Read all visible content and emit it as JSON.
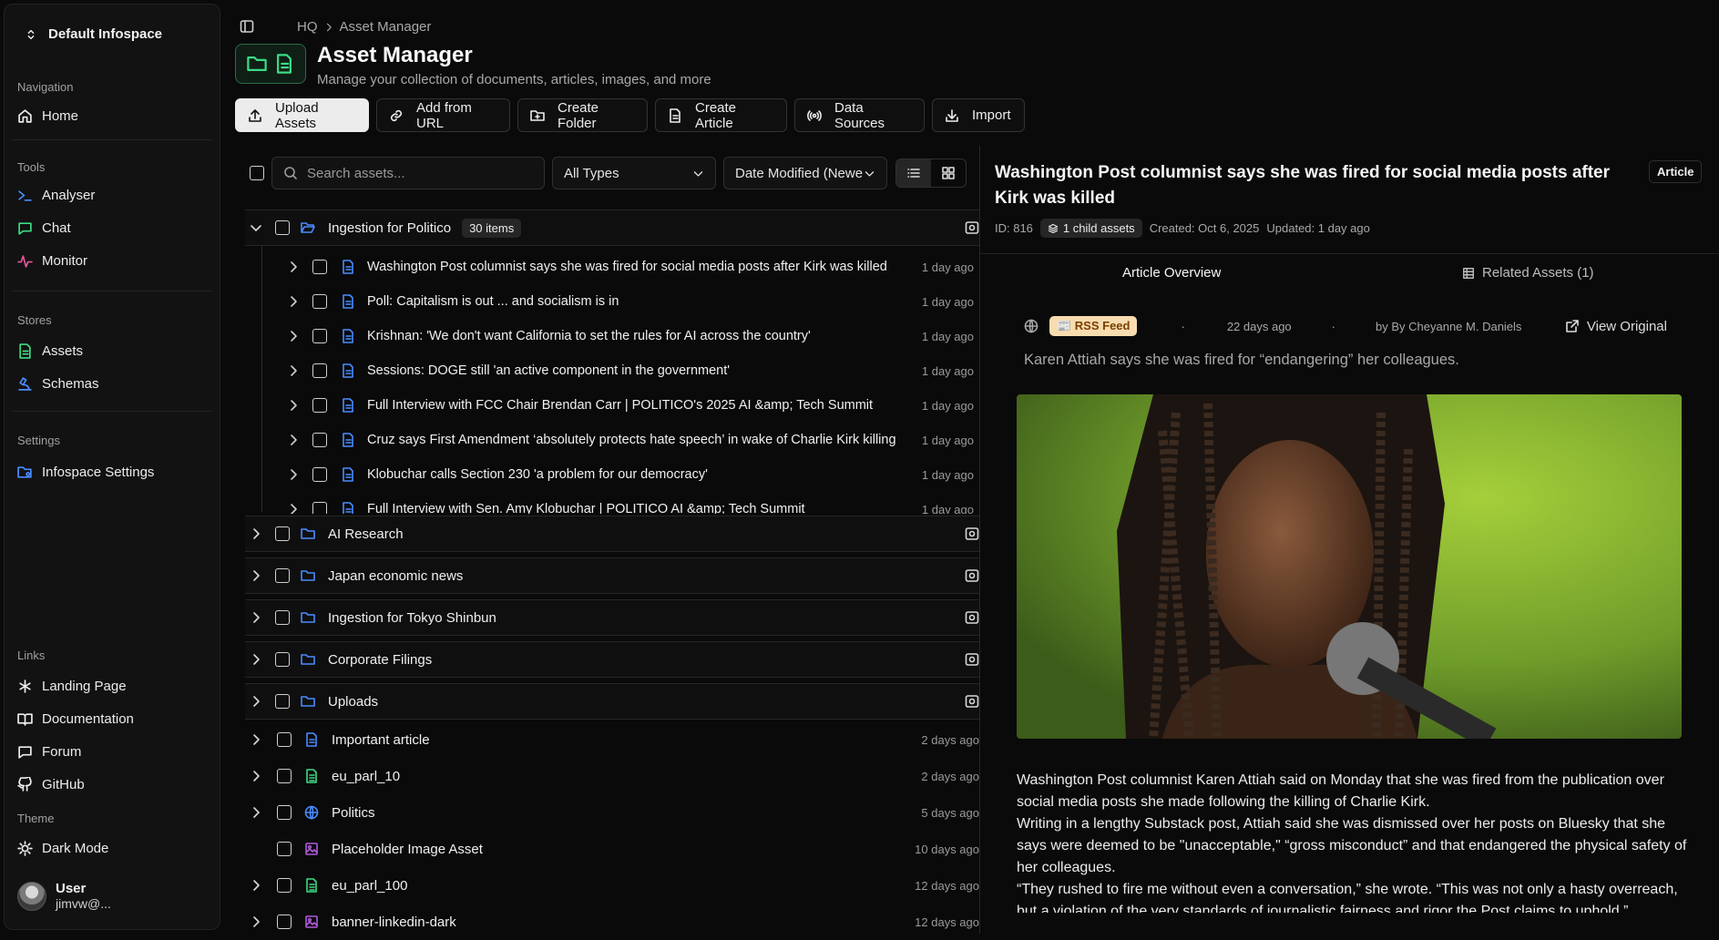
{
  "sidebar": {
    "workspace": "Default Infospace",
    "sections": {
      "navigation": "Navigation",
      "tools": "Tools",
      "stores": "Stores",
      "settings": "Settings",
      "links": "Links",
      "theme": "Theme"
    },
    "items": {
      "home": "Home",
      "analyser": "Analyser",
      "chat": "Chat",
      "monitor": "Monitor",
      "assets": "Assets",
      "schemas": "Schemas",
      "infospace_settings": "Infospace Settings",
      "landing": "Landing Page",
      "docs": "Documentation",
      "forum": "Forum",
      "github": "GitHub",
      "dark_mode": "Dark Mode"
    },
    "user": {
      "name": "User",
      "email": "jimvw@..."
    }
  },
  "header": {
    "breadcrumb": [
      "HQ",
      "Asset Manager"
    ],
    "title": "Asset Manager",
    "subtitle": "Manage your collection of documents, articles, images, and more"
  },
  "toolbar": {
    "upload": "Upload Assets",
    "add_url": "Add from URL",
    "create_folder": "Create Folder",
    "create_article": "Create Article",
    "data_sources": "Data Sources",
    "import": "Import"
  },
  "filters": {
    "search_placeholder": "Search assets...",
    "type": "All Types",
    "sort": "Date Modified (Newest)"
  },
  "tree": {
    "open_folder": {
      "name": "Ingestion for Politico",
      "count": "30 items",
      "children": [
        {
          "title": "Washington Post columnist says she was fired for social media posts after Kirk was killed",
          "date": "1 day ago"
        },
        {
          "title": "Poll: Capitalism is out ... and socialism is in",
          "date": "1 day ago"
        },
        {
          "title": "Krishnan: 'We don't want California to set the rules for AI across the country'",
          "date": "1 day ago"
        },
        {
          "title": "Sessions: DOGE still 'an active component in the government'",
          "date": "1 day ago"
        },
        {
          "title": "Full Interview with FCC Chair Brendan Carr | POLITICO's 2025 AI &amp; Tech Summit",
          "date": "1 day ago"
        },
        {
          "title": "Cruz says First Amendment ‘absolutely protects hate speech’ in wake of Charlie Kirk killing",
          "date": "1 day ago"
        },
        {
          "title": "Klobuchar calls Section 230 'a problem for our democracy'",
          "date": "1 day ago"
        },
        {
          "title": "Full Interview with Sen. Amy Klobuchar | POLITICO AI &amp; Tech Summit",
          "date": "1 day ago"
        }
      ]
    },
    "folders": [
      "AI Research",
      "Japan economic news",
      "Ingestion for Tokyo Shinbun",
      "Corporate Filings",
      "Uploads"
    ],
    "assets": [
      {
        "name": "Important article",
        "date": "2 days ago",
        "icon": "document-icon"
      },
      {
        "name": "eu_parl_10",
        "date": "2 days ago",
        "icon": "spreadsheet-icon"
      },
      {
        "name": "Politics",
        "date": "5 days ago",
        "icon": "globe-icon"
      },
      {
        "name": "Placeholder Image Asset",
        "date": "10 days ago",
        "icon": "image-icon"
      },
      {
        "name": "eu_parl_100",
        "date": "12 days ago",
        "icon": "spreadsheet-icon"
      },
      {
        "name": "banner-linkedin-dark",
        "date": "12 days ago",
        "icon": "image-icon"
      }
    ]
  },
  "detail": {
    "title": "Washington Post columnist says she was fired for social media posts after Kirk was killed",
    "kind": "Article",
    "id": "ID: 816",
    "child_assets": "1 child assets",
    "created": "Created: Oct 6, 2025",
    "updated": "Updated: 1 day ago",
    "tabs": [
      "Article Overview",
      "Related Assets (1)"
    ],
    "source": "📰 RSS Feed",
    "age": "22 days ago",
    "author": "by By Cheyanne M. Daniels",
    "view_original": "View Original",
    "lead": "Karen Attiah says she was fired for “endangering” her colleagues.",
    "body": [
      "Washington Post columnist Karen Attiah said on Monday that she was fired from the publication over social media posts she made following the killing of Charlie Kirk.",
      "Writing in a lengthy Substack post, Attiah said she was dismissed over her posts on Bluesky that she says were deemed to be \"unacceptable,\" “gross misconduct” and that endangered the physical safety of her colleagues.",
      "“They rushed to fire me without even a conversation,” she wrote. “This was not only a hasty overreach, but a violation of the very standards of journalistic fairness and rigor the Post claims to uphold.”"
    ]
  },
  "colors": {
    "accent_green": "#3ddc84",
    "folder_blue": "#4a8cff",
    "rss_badge": "#f6dcae"
  }
}
